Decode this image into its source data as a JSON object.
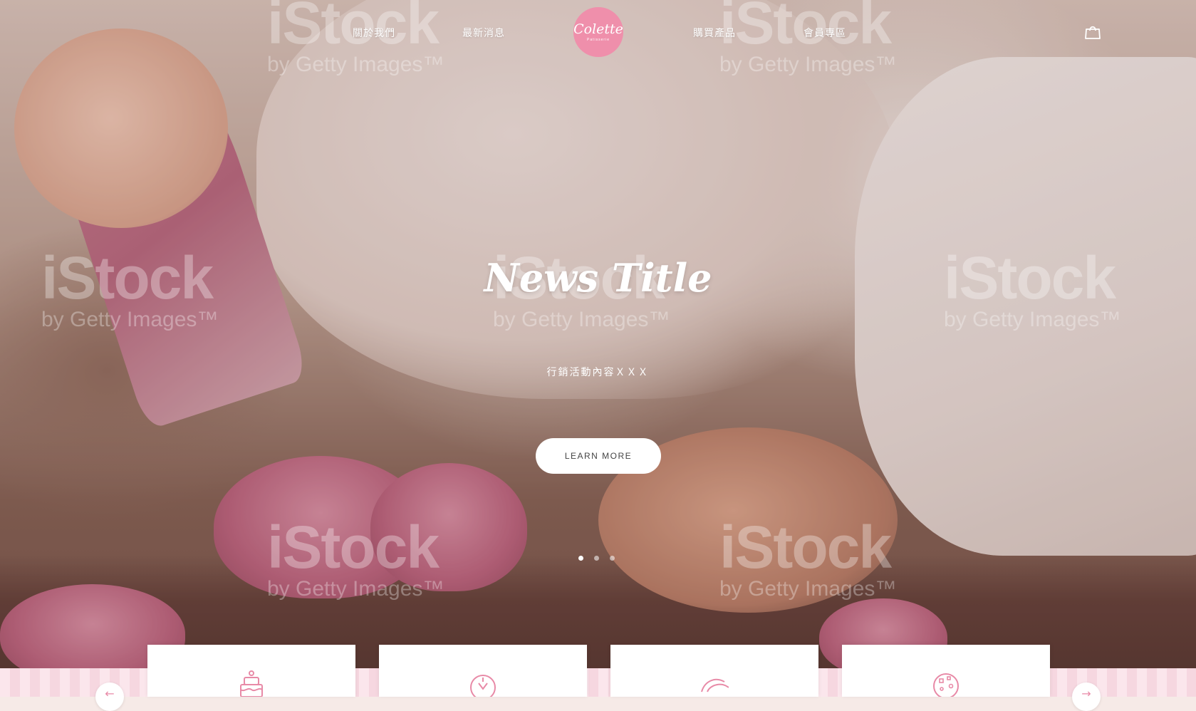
{
  "nav": {
    "links": [
      {
        "label": "關於我們"
      },
      {
        "label": "最新消息"
      },
      {
        "label": "購買產品"
      },
      {
        "label": "會員專區"
      }
    ],
    "logo": {
      "text": "Colette",
      "tagline": "Patisserie"
    },
    "cart_icon": "shopping-bag-icon"
  },
  "hero": {
    "title": "News Title",
    "subtitle": "行銷活動內容ＸＸＸ",
    "button_label": "LEARN MORE",
    "slides": {
      "count": 3,
      "active_index": 0
    }
  },
  "watermark": {
    "brand": "iStock",
    "byline": "by Getty Images™"
  },
  "categories": [
    {
      "icon": "cake-icon"
    },
    {
      "icon": "tart-icon"
    },
    {
      "icon": "macaron-icon"
    },
    {
      "icon": "cookie-icon"
    }
  ],
  "colors": {
    "brand_pink": "#ef8fab",
    "icon_pink": "#e88aa7",
    "strip_pink": "#fbe6ec"
  }
}
